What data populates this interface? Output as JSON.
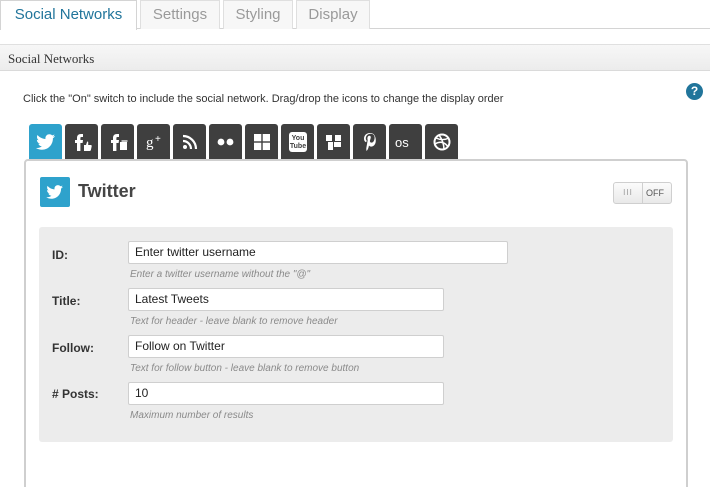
{
  "tabs": [
    {
      "label": "Social Networks",
      "active": true
    },
    {
      "label": "Settings",
      "active": false
    },
    {
      "label": "Styling",
      "active": false
    },
    {
      "label": "Display",
      "active": false
    }
  ],
  "section": {
    "title": "Social Networks"
  },
  "instructions": "Click the \"On\" switch to include the social network. Drag/drop the icons to change the display order",
  "help_icon": "?",
  "network_icons": [
    "twitter-icon",
    "facebook-icon",
    "facebook-page-icon",
    "google-plus-icon",
    "rss-icon",
    "flickr-icon",
    "delicious-icon",
    "youtube-icon",
    "digg-icon",
    "pinterest-icon",
    "lastfm-icon",
    "dribbble-icon"
  ],
  "panel": {
    "network_name": "Twitter",
    "switch_label": "OFF",
    "switch_handle": "III",
    "fields": {
      "id": {
        "label": "ID:",
        "value": "Enter twitter username",
        "help": "Enter a twitter username without the \"@\""
      },
      "title": {
        "label": "Title:",
        "value": "Latest Tweets",
        "help": "Text for header - leave blank to remove header"
      },
      "follow": {
        "label": "Follow:",
        "value": "Follow on Twitter",
        "help": "Text for follow button - leave blank to remove button"
      },
      "posts": {
        "label": "# Posts:",
        "value": "10",
        "help": "Maximum number of results"
      }
    }
  },
  "colors": {
    "accent": "#2ea2cc",
    "tab_dark": "#3f3f3f",
    "link": "#21759b"
  }
}
